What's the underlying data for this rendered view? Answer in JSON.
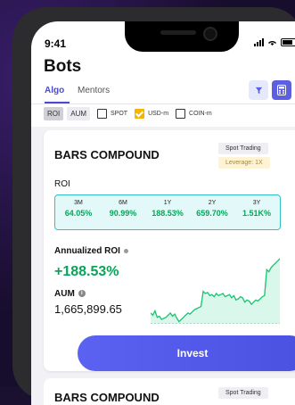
{
  "status": {
    "time": "9:41"
  },
  "page": {
    "title": "Bots"
  },
  "tabs": [
    {
      "label": "Algo",
      "active": true
    },
    {
      "label": "Mentors",
      "active": false
    }
  ],
  "filters": {
    "sort_chips": [
      {
        "label": "ROI",
        "active": true
      },
      {
        "label": "AUM",
        "active": false
      }
    ],
    "checkboxes": [
      {
        "label": "SPOT",
        "checked": false
      },
      {
        "label": "USD-m",
        "checked": true
      },
      {
        "label": "COIN-m",
        "checked": false
      }
    ]
  },
  "cards": [
    {
      "name": "BARS COMPOUND",
      "type_tag": "Spot Trading",
      "leverage_tag": "Leverage: 1X",
      "roi_label": "ROI",
      "roi": [
        {
          "period": "3M",
          "value": "64.05%"
        },
        {
          "period": "6M",
          "value": "90.99%"
        },
        {
          "period": "1Y",
          "value": "188.53%"
        },
        {
          "period": "2Y",
          "value": "659.70%"
        },
        {
          "period": "3Y",
          "value": "1.51K%"
        }
      ],
      "annualized_label": "Annualized ROI",
      "annualized_value": "+188.53%",
      "aum_label": "AUM",
      "aum_value": "1,665,899.65",
      "invest_label": "Invest"
    },
    {
      "name": "BARS COMPOUND",
      "type_tag": "Spot Trading"
    }
  ],
  "colors": {
    "accent": "#4a4ad8",
    "positive": "#0aa35b",
    "highlight": "#f5b400"
  },
  "sparkline": [
    60,
    62,
    58,
    64,
    63,
    66,
    65,
    64,
    62,
    60,
    63,
    61,
    65,
    68,
    66,
    64,
    62,
    60,
    61,
    59,
    57,
    56,
    55,
    54,
    40,
    42,
    41,
    44,
    43,
    45,
    42,
    44,
    43,
    42,
    45,
    44,
    43,
    46,
    44,
    48,
    47,
    45,
    46,
    50,
    48,
    49,
    52,
    50,
    48,
    49,
    47,
    45,
    44,
    20,
    22,
    18,
    16,
    14,
    12,
    10
  ]
}
